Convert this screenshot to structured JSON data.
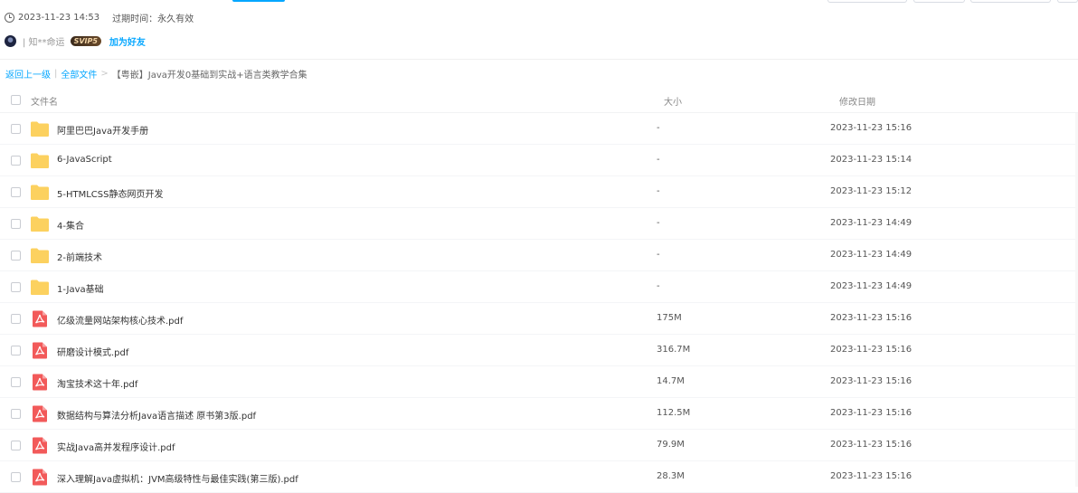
{
  "share_info": {
    "created": "2023-11-23 14:53",
    "expire_label": "过期时间：",
    "expire_value": "永久有效"
  },
  "user": {
    "name": "| 知**命运",
    "badge": "SVIP5",
    "add_friend": "加为好友"
  },
  "breadcrumb": {
    "back": "返回上一级",
    "sep1": "|",
    "all_files": "全部文件",
    "sep2": ">",
    "current": "【粤嵌】Java开发0基础到实战+语言类教学合集"
  },
  "columns": {
    "name": "文件名",
    "size": "大小",
    "modified": "修改日期"
  },
  "colors": {
    "accent": "#06a7ff",
    "folder": "#fcd15f",
    "pdf": "#f25a5a"
  },
  "files": [
    {
      "icon": "folder-icon",
      "name": "阿里巴巴Java开发手册",
      "size": "-",
      "date": "2023-11-23 15:16"
    },
    {
      "icon": "folder-icon",
      "name": "6-JavaScript",
      "size": "-",
      "date": "2023-11-23 15:14"
    },
    {
      "icon": "folder-icon",
      "name": "5-HTMLCSS静态网页开发",
      "size": "-",
      "date": "2023-11-23 15:12"
    },
    {
      "icon": "folder-icon",
      "name": "4-集合",
      "size": "-",
      "date": "2023-11-23 14:49"
    },
    {
      "icon": "folder-icon",
      "name": "2-前端技术",
      "size": "-",
      "date": "2023-11-23 14:49"
    },
    {
      "icon": "folder-icon",
      "name": "1-Java基础",
      "size": "-",
      "date": "2023-11-23 14:49"
    },
    {
      "icon": "pdf-icon",
      "name": "亿级流量网站架构核心技术.pdf",
      "size": "175M",
      "date": "2023-11-23 15:16"
    },
    {
      "icon": "pdf-icon",
      "name": "研磨设计模式.pdf",
      "size": "316.7M",
      "date": "2023-11-23 15:16"
    },
    {
      "icon": "pdf-icon",
      "name": "淘宝技术这十年.pdf",
      "size": "14.7M",
      "date": "2023-11-23 15:16"
    },
    {
      "icon": "pdf-icon",
      "name": "数据结构与算法分析Java语言描述 原书第3版.pdf",
      "size": "112.5M",
      "date": "2023-11-23 15:16"
    },
    {
      "icon": "pdf-icon",
      "name": "实战Java高并发程序设计.pdf",
      "size": "79.9M",
      "date": "2023-11-23 15:16"
    },
    {
      "icon": "pdf-icon",
      "name": "深入理解Java虚拟机：JVM高级特性与最佳实践(第三版).pdf",
      "size": "28.3M",
      "date": "2023-11-23 15:16"
    }
  ]
}
